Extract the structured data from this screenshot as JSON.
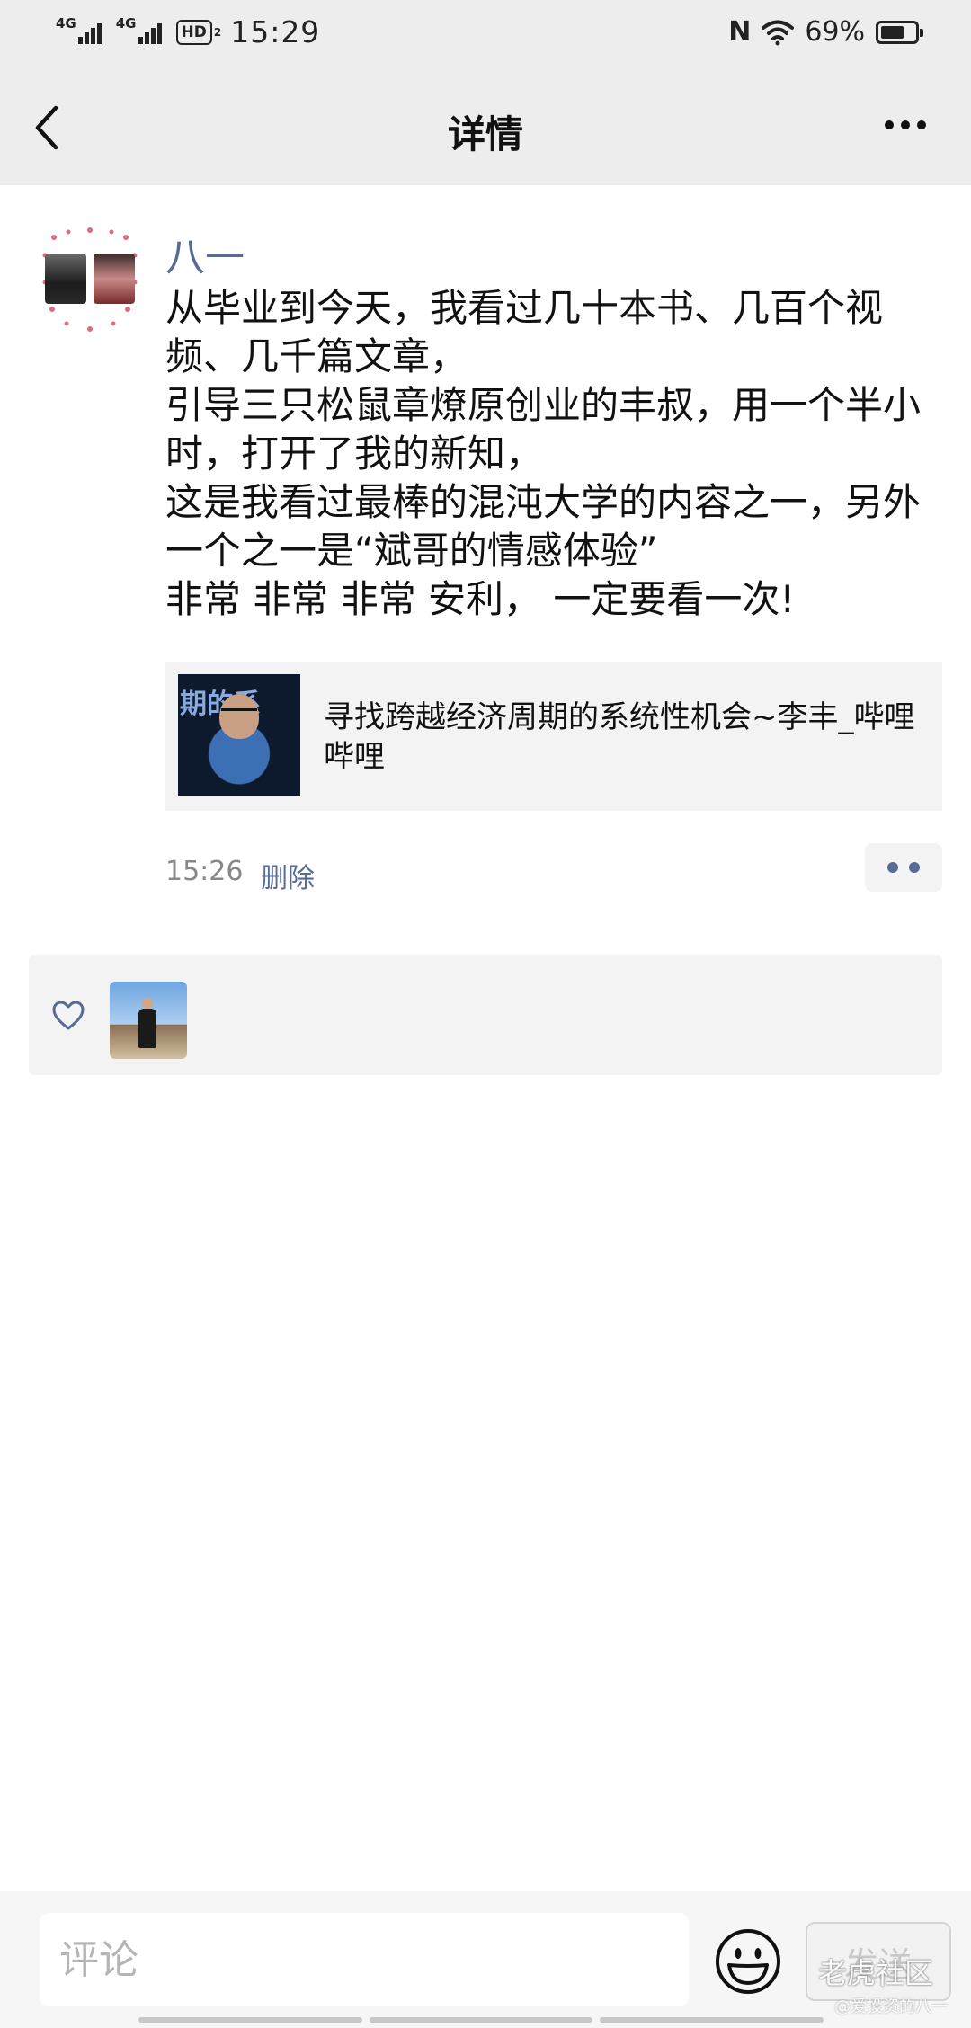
{
  "status_bar": {
    "signal1": "4G",
    "signal2": "4G",
    "hd": "HD",
    "hd_sub": "2",
    "time": "15:29",
    "nfc": "N",
    "battery_percent": "69%",
    "battery_level": 0.69
  },
  "nav": {
    "title": "详情"
  },
  "post": {
    "author": "八一",
    "text": "从毕业到今天，我看过几十本书、几百个视频、几千篇文章，\n引导三只松鼠章燎原创业的丰叔，用一个半小时，打开了我的新知，\n这是我看过最棒的混沌大学的内容之一，另外一个之一是“斌哥的情感体验”\n非常 非常 非常 安利， 一定要看一次!",
    "link": {
      "title": "寻找跨越经济周期的系统性机会~李丰_哔哩哔哩",
      "thumb_text": "期的系"
    },
    "time": "15:26",
    "delete_label": "删除"
  },
  "comment_bar": {
    "placeholder": "评论",
    "send_label": "发送"
  },
  "watermark": {
    "main": "老虎社区",
    "sub": "@爱投资的八一"
  },
  "colors": {
    "link_blue": "#576b95",
    "header_bg": "#ededed"
  }
}
